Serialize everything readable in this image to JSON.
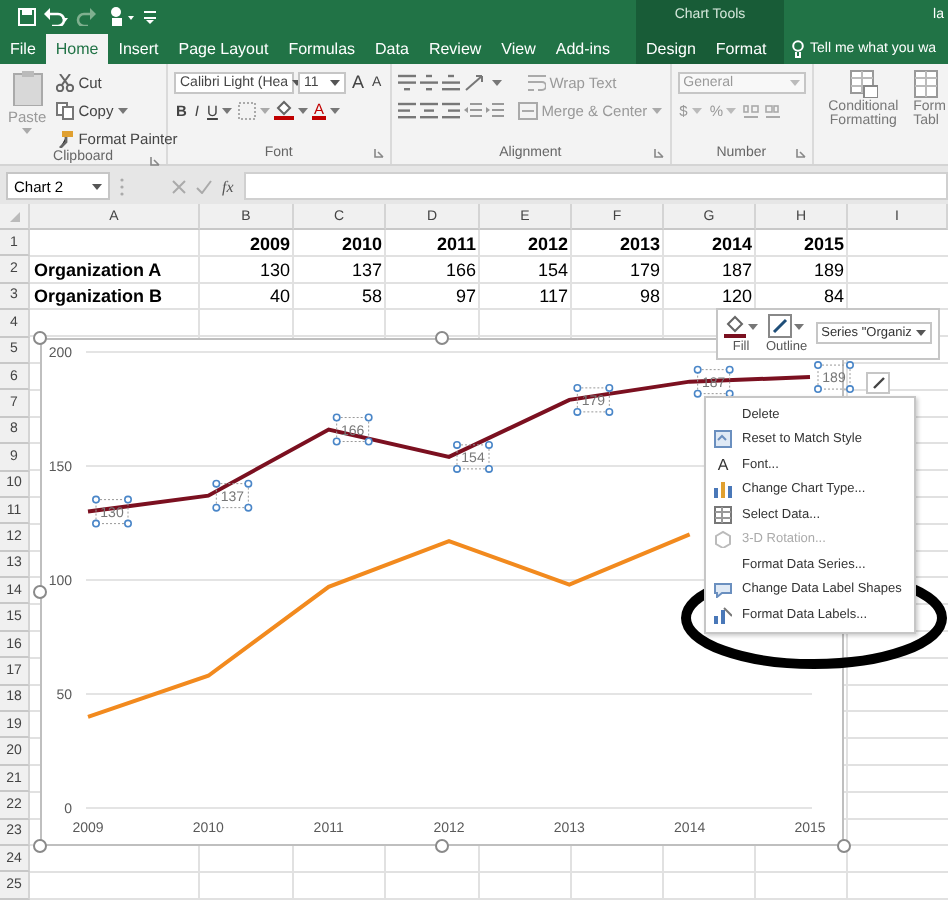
{
  "title_bar": {
    "context_label": "Chart Tools",
    "account": "la"
  },
  "tabs": [
    {
      "label": "File",
      "kind": "standard",
      "selected": false
    },
    {
      "label": "Home",
      "kind": "standard",
      "selected": true
    },
    {
      "label": "Insert",
      "kind": "standard",
      "selected": false
    },
    {
      "label": "Page Layout",
      "kind": "standard",
      "selected": false
    },
    {
      "label": "Formulas",
      "kind": "standard",
      "selected": false
    },
    {
      "label": "Data",
      "kind": "standard",
      "selected": false
    },
    {
      "label": "Review",
      "kind": "standard",
      "selected": false
    },
    {
      "label": "View",
      "kind": "standard",
      "selected": false
    },
    {
      "label": "Add-ins",
      "kind": "standard",
      "selected": false
    },
    {
      "label": "Design",
      "kind": "contextual",
      "selected": false
    },
    {
      "label": "Format",
      "kind": "contextual",
      "selected": false
    }
  ],
  "tell_me": {
    "placeholder": "Tell me what you wa"
  },
  "ribbon": {
    "clipboard": {
      "label": "Clipboard",
      "paste": "Paste",
      "cut": "Cut",
      "copy": "Copy",
      "format_painter": "Format Painter"
    },
    "font": {
      "label": "Font",
      "font_name": "Calibri Light (Hea",
      "font_size": "11",
      "grow": "A",
      "shrink": "A",
      "bold": "B",
      "italic": "I",
      "underline": "U",
      "font_color": "A"
    },
    "alignment": {
      "label": "Alignment",
      "wrap_text": "Wrap Text",
      "merge_center": "Merge & Center"
    },
    "number": {
      "label": "Number",
      "format": "General",
      "currency": "$",
      "percent": "%"
    },
    "styles": {
      "conditional_formatting": "Conditional Formatting",
      "format_as_table": "Form Tabl"
    }
  },
  "formula_bar": {
    "name_box": "Chart 2",
    "function_label": "fx"
  },
  "sheet": {
    "columns": [
      "A",
      "B",
      "C",
      "D",
      "E",
      "F",
      "G",
      "H",
      "I"
    ],
    "rows": [
      {
        "number": "1",
        "kind": "header",
        "values": [
          "2009",
          "2010",
          "2011",
          "2012",
          "2013",
          "2014",
          "2015"
        ]
      },
      {
        "number": "2",
        "kind": "data",
        "label": "Organization A",
        "values": [
          "130",
          "137",
          "166",
          "154",
          "179",
          "187",
          "189"
        ]
      },
      {
        "number": "3",
        "kind": "data",
        "label": "Organization B",
        "values": [
          "40",
          "58",
          "97",
          "117",
          "98",
          "120",
          "84"
        ]
      },
      {
        "number": "4",
        "kind": "empty"
      },
      {
        "number": "5",
        "kind": "empty"
      },
      {
        "number": "6",
        "kind": "empty"
      },
      {
        "number": "7",
        "kind": "empty"
      },
      {
        "number": "8",
        "kind": "empty"
      },
      {
        "number": "9",
        "kind": "empty"
      },
      {
        "number": "10",
        "kind": "empty"
      },
      {
        "number": "11",
        "kind": "empty"
      },
      {
        "number": "12",
        "kind": "empty"
      },
      {
        "number": "13",
        "kind": "empty"
      },
      {
        "number": "14",
        "kind": "empty"
      },
      {
        "number": "15",
        "kind": "empty"
      },
      {
        "number": "16",
        "kind": "empty"
      },
      {
        "number": "17",
        "kind": "empty"
      },
      {
        "number": "18",
        "kind": "empty"
      },
      {
        "number": "19",
        "kind": "empty"
      },
      {
        "number": "20",
        "kind": "empty"
      },
      {
        "number": "21",
        "kind": "empty"
      },
      {
        "number": "22",
        "kind": "empty"
      },
      {
        "number": "23",
        "kind": "empty"
      },
      {
        "number": "24",
        "kind": "empty"
      },
      {
        "number": "25",
        "kind": "empty"
      }
    ]
  },
  "chart": {
    "chart_data": {
      "type": "line",
      "categories": [
        "2009",
        "2010",
        "2011",
        "2012",
        "2013",
        "2014",
        "2015"
      ],
      "series": [
        {
          "color": "#7b1020",
          "values": [
            130,
            137,
            166,
            154,
            179,
            187,
            189
          ],
          "data_labels": true
        },
        {
          "color": "#f28a1e",
          "values": [
            40,
            58,
            97,
            117,
            98,
            120,
            null
          ],
          "data_labels": false
        }
      ],
      "ylim": [
        0,
        200
      ],
      "yticks": [
        0,
        50,
        100,
        150,
        200
      ],
      "grid": true
    },
    "labels_selected": true
  },
  "mini_toolbar": {
    "fill": "Fill",
    "outline": "Outline",
    "element_picker": "Series \"Organiz"
  },
  "context_menu": [
    {
      "label": "Delete",
      "kind": "none",
      "disabled": false
    },
    {
      "label": "Reset to Match Style",
      "kind": "reset",
      "disabled": false
    },
    {
      "label": "Font...",
      "kind": "font",
      "icon_text": "A",
      "disabled": false
    },
    {
      "label": "Change Chart Type...",
      "kind": "chart-type",
      "disabled": false
    },
    {
      "label": "Select Data...",
      "kind": "select-data",
      "disabled": false
    },
    {
      "label": "3-D Rotation...",
      "kind": "rotation",
      "disabled": true
    },
    {
      "label": "Format Data Series...",
      "kind": "none",
      "disabled": false
    },
    {
      "label": "Change Data Label Shapes",
      "kind": "label-shapes",
      "disabled": false
    },
    {
      "label": "Format Data Labels...",
      "kind": "format-labels",
      "disabled": false
    }
  ]
}
